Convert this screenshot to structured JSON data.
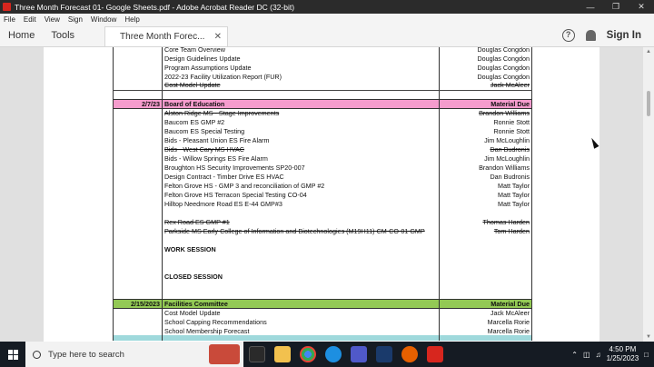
{
  "window": {
    "title": "Three Month Forecast 01- Google Sheets.pdf - Adobe Acrobat Reader DC (32-bit)"
  },
  "menu": [
    "File",
    "Edit",
    "View",
    "Sign",
    "Window",
    "Help"
  ],
  "nav": {
    "home": "Home",
    "tools": "Tools",
    "doc_tab": "Three Month Forec...",
    "sign_in": "Sign In"
  },
  "rows": [
    {
      "date": "",
      "item": "Core Team Overview",
      "who": "Douglas Congdon",
      "style": "",
      "strike": false
    },
    {
      "date": "",
      "item": "Design Guidelines Update",
      "who": "Douglas Congdon",
      "style": "",
      "strike": false
    },
    {
      "date": "",
      "item": "Program Assumptions Update",
      "who": "Douglas Congdon",
      "style": "",
      "strike": false
    },
    {
      "date": "",
      "item": "2022-23 Facility Utilization Report (FUR)",
      "who": "Douglas Congdon",
      "style": "",
      "strike": false
    },
    {
      "date": "",
      "item": "Cost Model Update",
      "who": "Jack McAleer",
      "style": "line",
      "strike": true
    },
    {
      "date": "",
      "item": "",
      "who": "",
      "style": "",
      "strike": false
    },
    {
      "date": "2/7/23",
      "item": "Board of Education",
      "who": "Material Due",
      "style": "pink",
      "strike": false
    },
    {
      "date": "",
      "item": "Alston Ridge MS - Stage Improvements",
      "who": "Brandon Williams",
      "style": "",
      "strike": true
    },
    {
      "date": "",
      "item": "Baucom ES GMP #2",
      "who": "Ronnie Stott",
      "style": "",
      "strike": false
    },
    {
      "date": "",
      "item": "Baucom ES Special Testing",
      "who": "Ronnie Stott",
      "style": "",
      "strike": false
    },
    {
      "date": "",
      "item": "Bids - Pleasant Union ES Fire Alarm",
      "who": "Jim McLoughlin",
      "style": "",
      "strike": false
    },
    {
      "date": "",
      "item": "Bids - West Cary MS HVAC",
      "who": "Dan Budronis",
      "style": "",
      "strike": true
    },
    {
      "date": "",
      "item": "Bids - Willow Springs ES Fire Alarm",
      "who": "Jim McLoughlin",
      "style": "",
      "strike": false
    },
    {
      "date": "",
      "item": "Broughton HS Security Improvements SP20-007",
      "who": "Brandon Williams",
      "style": "",
      "strike": false
    },
    {
      "date": "",
      "item": "Design Contract - Timber Drive ES HVAC",
      "who": "Dan Budronis",
      "style": "",
      "strike": false
    },
    {
      "date": "",
      "item": "Felton Grove HS - GMP 3 and reconciliation of GMP #2",
      "who": "Matt Taylor",
      "style": "",
      "strike": false
    },
    {
      "date": "",
      "item": "Felton Grove HS Terracon Special Testing CO-04",
      "who": "Matt Taylor",
      "style": "",
      "strike": false
    },
    {
      "date": "",
      "item": "Hilltop Needmore Road ES E-44 GMP#3",
      "who": "Matt Taylor",
      "style": "",
      "strike": false
    },
    {
      "date": "",
      "item": "",
      "who": "",
      "style": "",
      "strike": false
    },
    {
      "date": "",
      "item": "Rex Road ES GMP #1",
      "who": "Thomas Harden",
      "style": "",
      "strike": true
    },
    {
      "date": "",
      "item": "Parkside MS Early College of Information and Biotechnologies (M19H11) CM-CO-01 GMP",
      "who": "Tom Harden",
      "style": "",
      "strike": true
    },
    {
      "date": "",
      "item": "",
      "who": "",
      "style": "",
      "strike": false
    },
    {
      "date": "",
      "item": "WORK SESSION",
      "who": "",
      "style": "bold",
      "strike": false
    },
    {
      "date": "",
      "item": "",
      "who": "",
      "style": "",
      "strike": false
    },
    {
      "date": "",
      "item": "",
      "who": "",
      "style": "",
      "strike": false
    },
    {
      "date": "",
      "item": "CLOSED SESSION",
      "who": "",
      "style": "bold",
      "strike": false
    },
    {
      "date": "",
      "item": "",
      "who": "",
      "style": "",
      "strike": false
    },
    {
      "date": "",
      "item": "",
      "who": "",
      "style": "",
      "strike": false
    },
    {
      "date": "2/15/2023",
      "item": "Facilities Committee",
      "who": "Material Due",
      "style": "green",
      "strike": false
    },
    {
      "date": "",
      "item": "Cost Model Update",
      "who": "Jack McAleer",
      "style": "",
      "strike": false
    },
    {
      "date": "",
      "item": "School Capping Recommendations",
      "who": "Marcella Rorie",
      "style": "",
      "strike": false
    },
    {
      "date": "",
      "item": "School Membership Forecast",
      "who": "Marcella Rorie",
      "style": "",
      "strike": false
    },
    {
      "date": "",
      "item": "",
      "who": "",
      "style": "teal",
      "strike": false
    }
  ],
  "taskbar": {
    "search_placeholder": "Type here to search",
    "time": "4:50 PM",
    "date": "1/25/2023"
  },
  "colors": {
    "board_row": "#f59ccd",
    "committee_row": "#93c955",
    "acrobat_red": "#d7261e"
  }
}
